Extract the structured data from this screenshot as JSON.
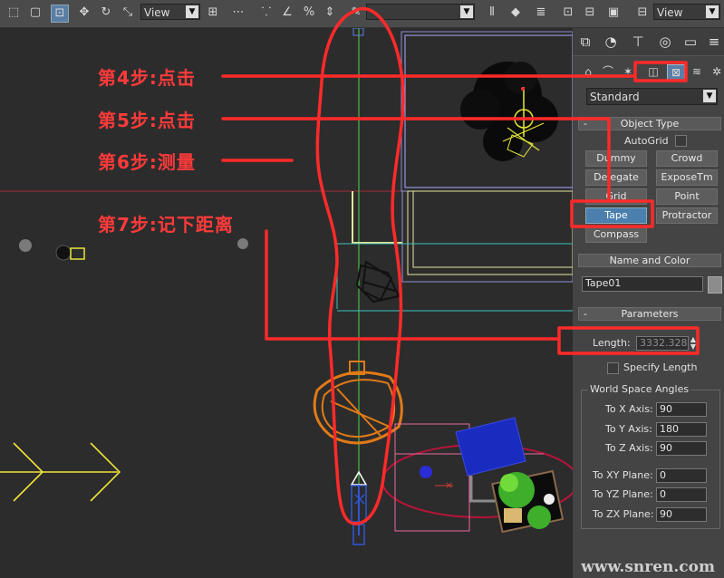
{
  "toolbar": {
    "view_left": "View",
    "view_right": "View"
  },
  "annotations": {
    "step4": "第4步:点击",
    "step5": "第5步:点击",
    "step6": "第6步:测量",
    "step7": "第7步:记下距离",
    "color": "#ff2a2a"
  },
  "panel": {
    "category_dropdown": "Standard",
    "object_type": {
      "title": "Object Type",
      "autogrid_label": "AutoGrid",
      "buttons": [
        "Dummy",
        "Crowd",
        "Delegate",
        "ExposeTm",
        "Grid",
        "Point",
        "Tape",
        "Protractor",
        "Compass"
      ],
      "active": "Tape"
    },
    "name_and_color": {
      "title": "Name and Color",
      "name_value": "Tape01",
      "swatch_color": "#8c8c8c"
    },
    "parameters": {
      "title": "Parameters",
      "length_label": "Length:",
      "length_value": "3332.328",
      "specify_length_label": "Specify Length",
      "world_space_angles_title": "World Space Angles",
      "angles": [
        {
          "label": "To X Axis:",
          "value": "90"
        },
        {
          "label": "To Y Axis:",
          "value": "180"
        },
        {
          "label": "To Z Axis:",
          "value": "90"
        },
        {
          "label": "To XY Plane:",
          "value": "0"
        },
        {
          "label": "To YZ Plane:",
          "value": "0"
        },
        {
          "label": "To ZX Plane:",
          "value": "90"
        }
      ]
    }
  },
  "watermark": "www.snren.com"
}
